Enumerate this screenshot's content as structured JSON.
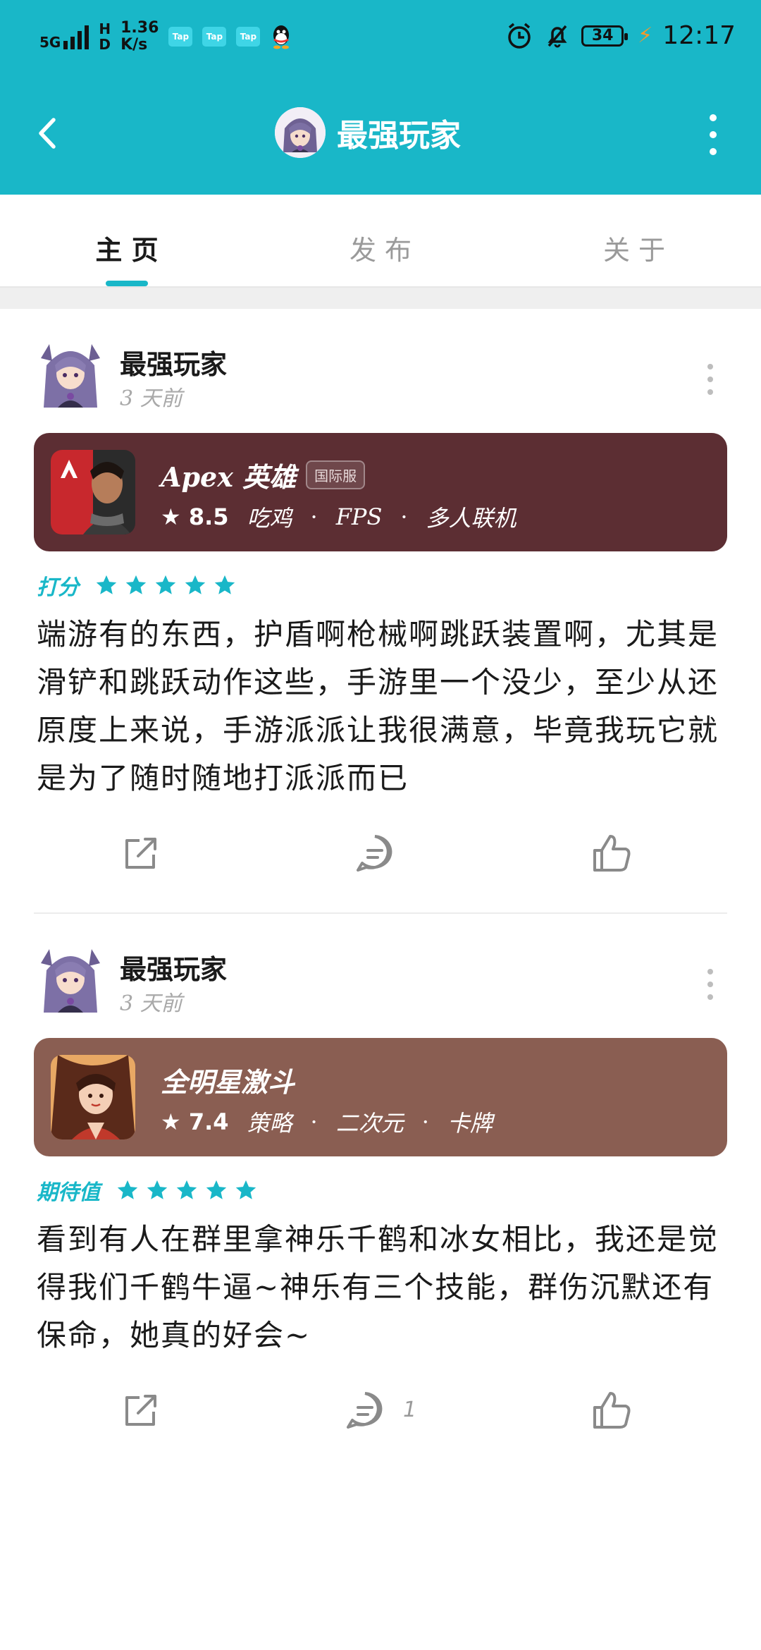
{
  "status_bar": {
    "network": "5G",
    "hd": [
      "H",
      "D"
    ],
    "net_speed": [
      "1.36",
      "K/s"
    ],
    "app_icons": [
      "Tap",
      "Tap",
      "Tap"
    ],
    "battery": "34",
    "time": "12:17"
  },
  "header": {
    "title": "最强玩家"
  },
  "tabs": [
    {
      "label": "主 页",
      "active": true
    },
    {
      "label": "发 布",
      "active": false
    },
    {
      "label": "关 于",
      "active": false
    }
  ],
  "posts": [
    {
      "author": "最强玩家",
      "time": "3 天前",
      "game": {
        "name": "Apex 英雄",
        "badge": "国际服",
        "score": "8.5",
        "tags": [
          "吃鸡",
          "FPS",
          "多人联机"
        ],
        "card_color": "#5c2e33"
      },
      "rating_label": "打分",
      "stars": 5,
      "text": "端游有的东西，护盾啊枪械啊跳跃装置啊，尤其是滑铲和跳跃动作这些，手游里一个没少，至少从还原度上来说，手游派派让我很满意，毕竟我玩它就是为了随时随地打派派而已",
      "comment_count": ""
    },
    {
      "author": "最强玩家",
      "time": "3 天前",
      "game": {
        "name": "全明星激斗",
        "badge": "",
        "score": "7.4",
        "tags": [
          "策略",
          "二次元",
          "卡牌"
        ],
        "card_color": "#8a5e52"
      },
      "rating_label": "期待值",
      "stars": 5,
      "text": "看到有人在群里拿神乐千鹤和冰女相比，我还是觉得我们千鹤牛逼~神乐有三个技能，群伤沉默还有保命，她真的好会~",
      "comment_count": "1"
    }
  ],
  "colors": {
    "accent": "#19b7c8",
    "header_bg": "#19b7c8",
    "star": "#19b7c8"
  }
}
